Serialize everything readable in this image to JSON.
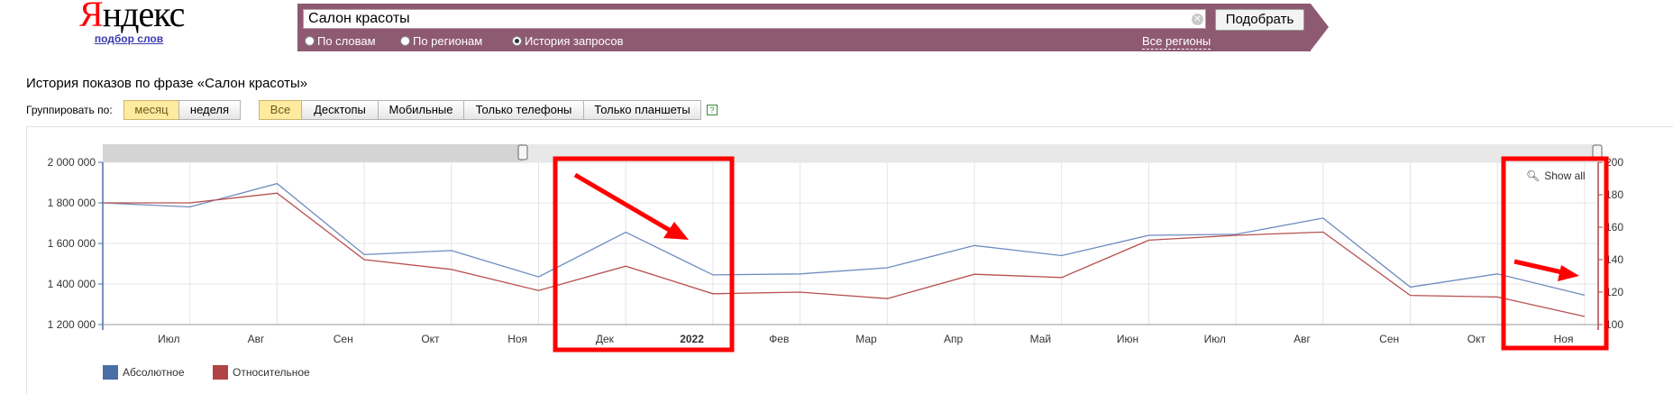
{
  "logo": {
    "text_red": "Я",
    "text_rest": "ндекс",
    "sub": "подбор слов"
  },
  "search": {
    "value": "Салон красоты",
    "button": "Подобрать",
    "modes": [
      {
        "label": "По словам",
        "selected": false
      },
      {
        "label": "По регионам",
        "selected": false
      },
      {
        "label": "История запросов",
        "selected": true
      }
    ],
    "regions_link": "Все регионы"
  },
  "page_title": "История показов по фразе «Салон красоты»",
  "grouping": {
    "label": "Группировать по:",
    "options": [
      "месяц",
      "неделя"
    ],
    "selected": "месяц"
  },
  "devices": {
    "options": [
      "Все",
      "Десктопы",
      "Мобильные",
      "Только телефоны",
      "Только планшеты"
    ],
    "selected": "Все",
    "help": "?"
  },
  "show_all": "Show all",
  "colors": {
    "absolute": "#6e8bbf",
    "relative": "#b85050",
    "annotation": "#ff0000"
  },
  "chart_data": {
    "type": "line",
    "x_labels": [
      "Июл",
      "Авг",
      "Сен",
      "Окт",
      "Ноя",
      "Дек",
      "2022",
      "Фев",
      "Мар",
      "Апр",
      "Май",
      "Июн",
      "Июл",
      "Авг",
      "Сен",
      "Окт",
      "Ноя"
    ],
    "x_label_bold": [
      false,
      false,
      false,
      false,
      false,
      false,
      true,
      false,
      false,
      false,
      false,
      false,
      false,
      false,
      false,
      false,
      false
    ],
    "y_left": {
      "min": 1200000,
      "max": 2000000,
      "ticks": [
        "1 200 000",
        "1 400 000",
        "1 600 000",
        "1 800 000",
        "2 000 000"
      ]
    },
    "y_right": {
      "min": 100,
      "max": 200,
      "ticks": [
        "100",
        "120",
        "140",
        "160",
        "180",
        "200"
      ]
    },
    "series": [
      {
        "name": "Абсолютное",
        "axis": "left",
        "values": [
          1800000,
          1780000,
          1895000,
          1545000,
          1565000,
          1435000,
          1655000,
          1445000,
          1450000,
          1480000,
          1590000,
          1540000,
          1640000,
          1645000,
          1725000,
          1385000,
          1450000,
          1345000
        ]
      },
      {
        "name": "Относительное",
        "axis": "right",
        "values": [
          175,
          175,
          181,
          140,
          134,
          121,
          136,
          119,
          120,
          116,
          131,
          129,
          152,
          155,
          157,
          118,
          117,
          105
        ]
      }
    ]
  }
}
